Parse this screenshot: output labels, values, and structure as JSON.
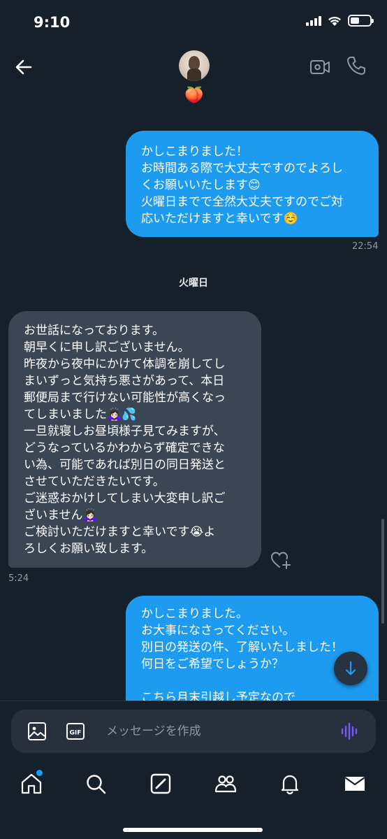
{
  "status_bar": {
    "time": "9:10"
  },
  "header": {
    "back_label": "Back",
    "avatar_alt": "avatar",
    "sub_emoji": "🍑"
  },
  "messages": [
    {
      "type": "sent",
      "text": "かしこまりました！\nお時間ある際で大丈夫ですのでよろし\nくお願いいたします😊\n火曜日までで全然大丈夫ですのでご対\n応いただけますと幸いです☺️",
      "time": "22:54"
    },
    {
      "type": "day",
      "text": "火曜日"
    },
    {
      "type": "received",
      "text": "お世話になっております。\n朝早くに申し訳ございません。\n昨夜から夜中にかけて体調を崩してし\nまいずっと気持ち悪さがあって、本日\n郵便局まで行けない可能性が高くなっ\nてしまいました🙇🏻‍♀️💦\n一旦就寝しお昼頃様子見てみますが、\nどうなっているかわからず確定できな\nい為、可能であれば別日の同日発送と\nさせていただきたいです。\nご迷惑おかけしてしまい大変申し訳ご\nざいません🙇🏻‍♀️\nご検討いただけますと幸いです😭よ\nろしくお願い致します。",
      "time": "5:24"
    },
    {
      "type": "sent",
      "text": "かしこまりました。\nお大事になさってください。\n別日の発送の件、了解いたしました！\n何日をご希望でしょうか？\n\nこちら月末引越し予定なので"
    }
  ],
  "composer": {
    "placeholder": "メッセージを作成",
    "gif_label": "GIF"
  },
  "colors": {
    "background": "#15202b",
    "sent_bubble": "#1d9bf0",
    "received_bubble": "#3a4653",
    "accent": "#1d9bf0",
    "voice_icon": "#7856ff"
  },
  "tabs": [
    {
      "icon": "home-icon",
      "active": true,
      "has_notification_dot": true
    },
    {
      "icon": "search-icon",
      "active": false
    },
    {
      "icon": "grok-icon",
      "active": false
    },
    {
      "icon": "communities-icon",
      "active": false
    },
    {
      "icon": "bell-icon",
      "active": false
    },
    {
      "icon": "mail-icon",
      "active": true
    }
  ]
}
